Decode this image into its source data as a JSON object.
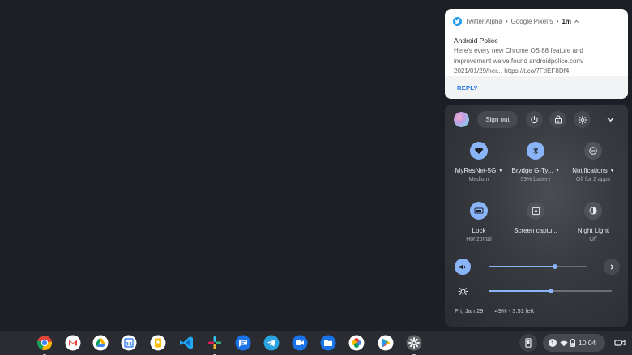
{
  "notification": {
    "app_name": "Twitter Alpha",
    "separator": "•",
    "device": "Google Pixel 5",
    "time": "1m",
    "title": "Android Police",
    "body_line1": "Here's every new Chrome OS 88 feature and",
    "body_line2": "improvement we've found androidpolice.com/",
    "body_line3": "2021/01/29/her... https://t.co/7FtIEF8Df4",
    "reply_label": "REPLY"
  },
  "quick_settings": {
    "sign_out_label": "Sign out",
    "tiles": [
      {
        "label": "MyResNet-5G",
        "sublabel": "Medium",
        "icon": "wifi-icon",
        "state": "on",
        "has_caret": true
      },
      {
        "label": "Brydge G-Ty...",
        "sublabel": "59% battery",
        "icon": "bluetooth-icon",
        "state": "on",
        "has_caret": true
      },
      {
        "label": "Notifications",
        "sublabel": "Off for 2 apps",
        "icon": "do-not-disturb-icon",
        "state": "off",
        "has_caret": true
      },
      {
        "label": "Lock",
        "sublabel": "Horizontal",
        "icon": "screen-rotation-lock-icon",
        "state": "on",
        "has_caret": false
      },
      {
        "label": "Screen captu...",
        "sublabel": "",
        "icon": "screen-capture-icon",
        "state": "off",
        "has_caret": false
      },
      {
        "label": "Night Light",
        "sublabel": "Off",
        "icon": "night-light-icon",
        "state": "off",
        "has_caret": false
      }
    ],
    "volume_level": 0.67,
    "brightness_level": 0.5,
    "date": "Fri, Jan 29",
    "battery_status": "49% - 3:51 left",
    "footer_separator": "|"
  },
  "shelf": {
    "apps": [
      "Chrome",
      "Gmail",
      "Google Drive",
      "Google Calendar",
      "Google Keep",
      "Visual Studio Code",
      "Slack",
      "Messages",
      "Telegram",
      "Duo",
      "Files",
      "Google Photos",
      "Play Store",
      "Settings"
    ],
    "notification_count": "1",
    "clock": "10:04"
  },
  "colors": {
    "accent": "#8ab4f8",
    "twitter": "#1d9bf0",
    "reply": "#1a73e8"
  }
}
